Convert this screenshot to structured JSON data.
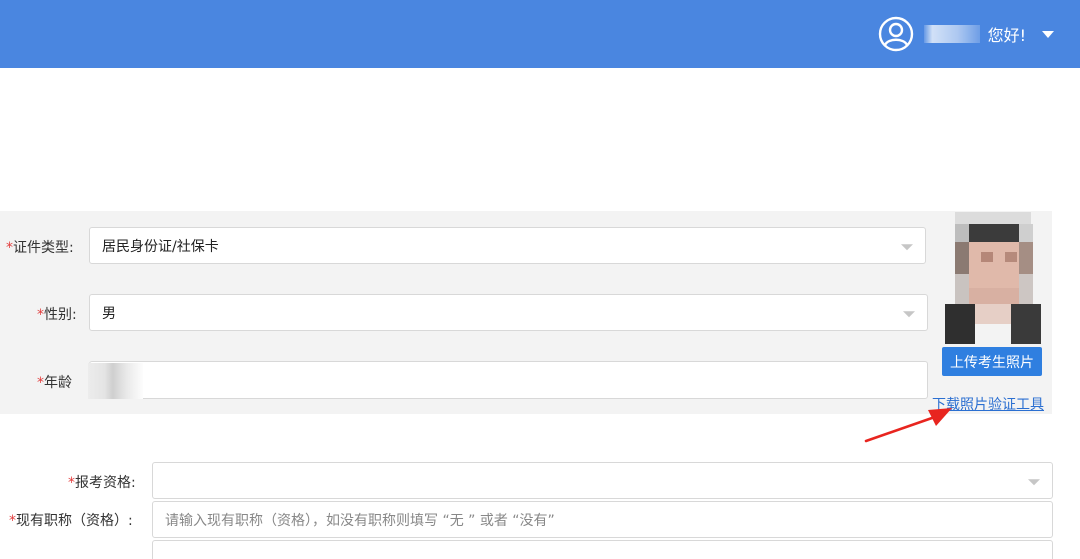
{
  "header": {
    "greeting": "您好!",
    "user_icon": "user-circle-icon",
    "dropdown_icon": "caret-down-icon",
    "bg_color": "#4a86e0"
  },
  "form_top": {
    "id_type": {
      "required_mark": "*",
      "label": "证件类型:",
      "value": "居民身份证/社保卡"
    },
    "gender": {
      "required_mark": "*",
      "label": "性别:",
      "value": "男"
    },
    "age": {
      "required_mark": "*",
      "label": "年龄"
    }
  },
  "photo": {
    "upload_button": "上传考生照片",
    "download_tool_link": "下载照片验证工具"
  },
  "form_bottom": {
    "qualification": {
      "required_mark": "*",
      "label": "报考资格:"
    },
    "current_title": {
      "required_mark": "*",
      "label": "现有职称（资格）:",
      "placeholder": "请输入现有职称（资格），如没有职称则填写 “无 ” 或者 “没有”"
    }
  },
  "colors": {
    "required": "#e23c3c",
    "link": "#2b6fd1",
    "button": "#2f7fe0",
    "annotation_arrow": "#e8251f"
  }
}
